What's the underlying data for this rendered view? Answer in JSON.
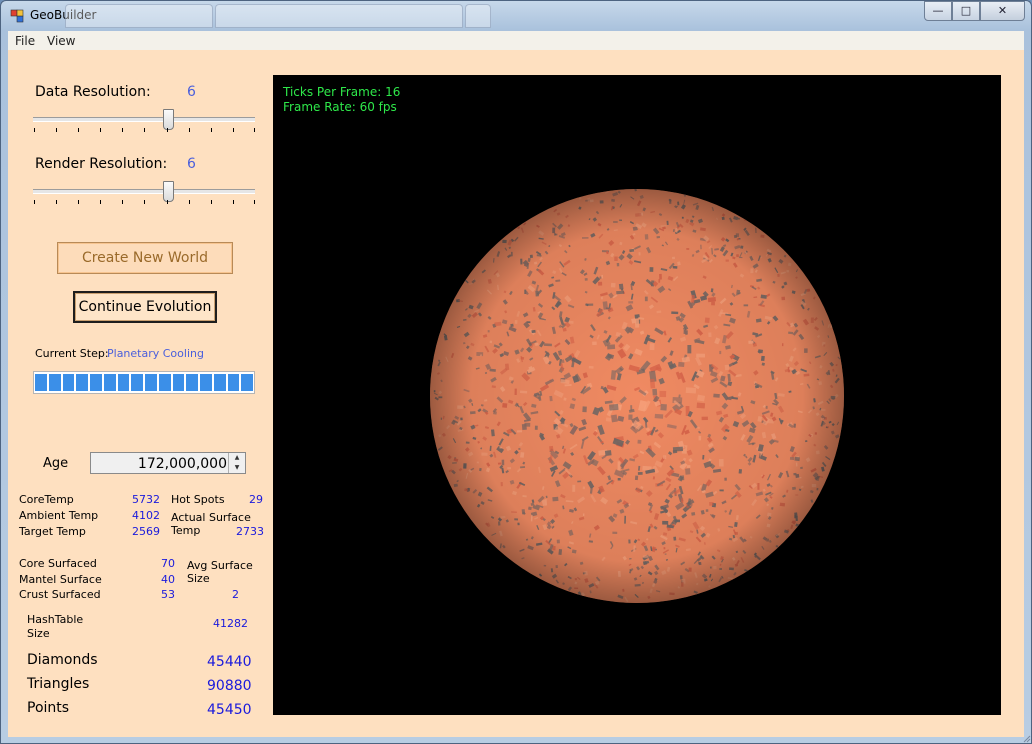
{
  "window": {
    "title": "GeoBuilder"
  },
  "menu": {
    "file": "File",
    "view": "View"
  },
  "sliders": {
    "data_label": "Data Resolution:",
    "data_value": "6",
    "render_label": "Render Resolution:",
    "render_value": "6"
  },
  "buttons": {
    "create": "Create New World",
    "continue": "Continue Evolution"
  },
  "status": {
    "step_label": "Current Step:",
    "step_value": "Planetary Cooling",
    "progress": 1.0
  },
  "age": {
    "label": "Age",
    "value": "172,000,000"
  },
  "stats": {
    "core_temp_label": "CoreTemp",
    "core_temp": "5732",
    "ambient_temp_label": "Ambient Temp",
    "ambient_temp": "4102",
    "target_temp_label": "Target Temp",
    "target_temp": "2569",
    "hot_spots_label": "Hot Spots",
    "hot_spots": "29",
    "actual_surface_label_1": "Actual Surface",
    "actual_surface_label_2": "Temp",
    "actual_surface": "2733",
    "core_surfaced_label": "Core Surfaced",
    "core_surfaced": "70",
    "mantel_surface_label": "Mantel Surface",
    "mantel_surface": "40",
    "crust_surfaced_label": "Crust Surfaced",
    "crust_surfaced": "53",
    "avg_surface_label_1": "Avg Surface",
    "avg_surface_label_2": "Size",
    "avg_surface": "2",
    "hashtable_label_1": "HashTable",
    "hashtable_label_2": "Size",
    "hashtable": "41282",
    "diamonds_label": "Diamonds",
    "diamonds": "45440",
    "triangles_label": "Triangles",
    "triangles": "90880",
    "points_label": "Points",
    "points": "45450"
  },
  "viewport": {
    "ticks": "Ticks Per Frame: 16",
    "frame_rate": "Frame Rate: 60 fps"
  },
  "colors": {
    "value_blue": "#1a1adc",
    "hud_green": "#2ee84a",
    "panel_bg": "#fee0c0",
    "progress_fill": "#3b8fe8",
    "planet_base": "#f08a62",
    "planet_dark": "#6e6664"
  }
}
